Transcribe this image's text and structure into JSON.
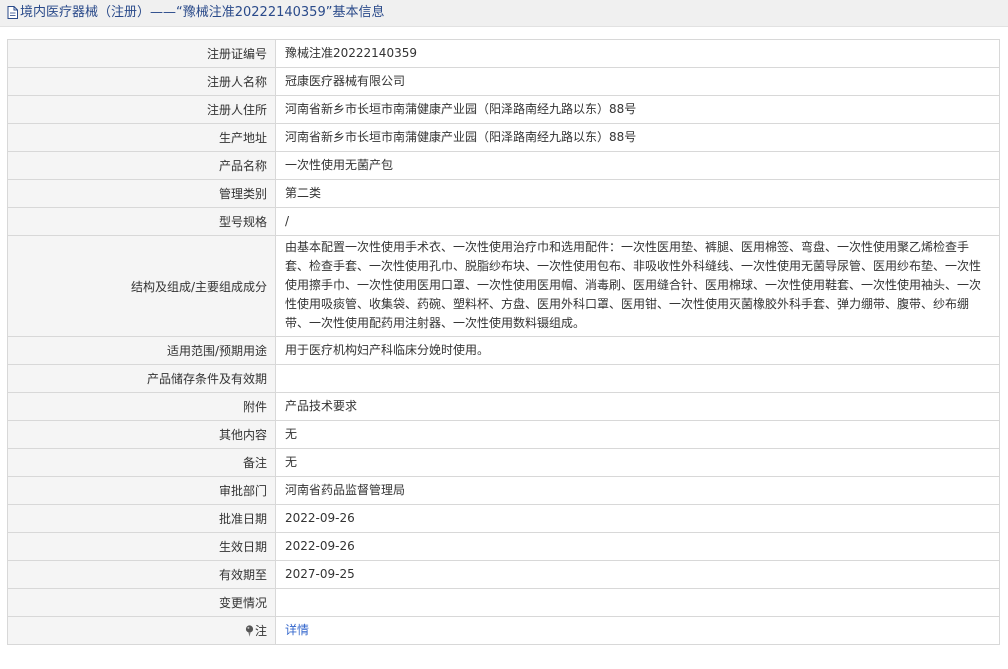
{
  "page": {
    "title": "境内医疗器械（注册）——“豫械注准20222140359”基本信息",
    "colors": {
      "title_text": "#2a4a8a",
      "link": "#3366cc",
      "label_bg": "#f5f5f5",
      "border": "#d8d8d8"
    }
  },
  "rows": {
    "reg_no": {
      "label": "注册证编号",
      "value": "豫械注准20222140359"
    },
    "registrant": {
      "label": "注册人名称",
      "value": "冠康医疗器械有限公司"
    },
    "registrant_address": {
      "label": "注册人住所",
      "value": "河南省新乡市长垣市南蒲健康产业园（阳泽路南经九路以东）88号"
    },
    "production_address": {
      "label": "生产地址",
      "value": "河南省新乡市长垣市南蒲健康产业园（阳泽路南经九路以东）88号"
    },
    "product_name": {
      "label": "产品名称",
      "value": "一次性使用无菌产包"
    },
    "category": {
      "label": "管理类别",
      "value": "第二类"
    },
    "model": {
      "label": "型号规格",
      "value": "/"
    },
    "structure": {
      "label": "结构及组成/主要组成成分",
      "value": "由基本配置一次性使用手术衣、一次性使用治疗巾和选用配件：一次性医用垫、裤腿、医用棉签、弯盘、一次性使用聚乙烯检查手套、检查手套、一次性使用孔巾、脱脂纱布块、一次性使用包布、非吸收性外科缝线、一次性使用无菌导尿管、医用纱布垫、一次性使用擦手巾、一次性使用医用口罩、一次性使用医用帽、消毒刷、医用缝合针、医用棉球、一次性使用鞋套、一次性使用袖头、一次性使用吸痰管、收集袋、药碗、塑料杯、方盘、医用外科口罩、医用钳、一次性使用灭菌橡胶外科手套、弹力绷带、腹带、纱布绷带、一次性使用配药用注射器、一次性使用数料镊组成。"
    },
    "scope": {
      "label": "适用范围/预期用途",
      "value": "用于医疗机构妇产科临床分娩时使用。"
    },
    "storage": {
      "label": "产品储存条件及有效期",
      "value": ""
    },
    "attachment": {
      "label": "附件",
      "value": "产品技术要求"
    },
    "other": {
      "label": "其他内容",
      "value": "无"
    },
    "remark": {
      "label": "备注",
      "value": "无"
    },
    "approval_dept": {
      "label": "审批部门",
      "value": "河南省药品监督管理局"
    },
    "approval_date": {
      "label": "批准日期",
      "value": "2022-09-26"
    },
    "effective_date": {
      "label": "生效日期",
      "value": "2022-09-26"
    },
    "expiry_date": {
      "label": "有效期至",
      "value": "2027-09-25"
    },
    "changes": {
      "label": "变更情况",
      "value": ""
    },
    "note": {
      "label": "注",
      "value": "详情",
      "icon": "pin-icon"
    }
  }
}
